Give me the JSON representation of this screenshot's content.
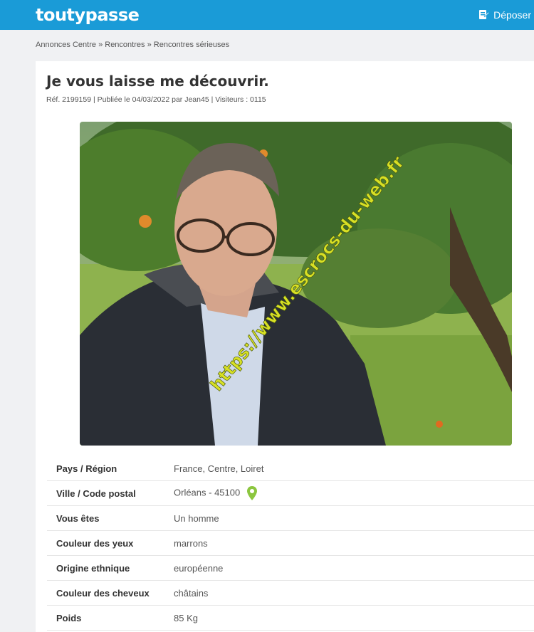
{
  "header": {
    "logo": "toutypasse",
    "deposer_label": "Déposer"
  },
  "breadcrumb": [
    "Annonces Centre",
    "Rencontres",
    "Rencontres sérieuses"
  ],
  "breadcrumb_sep": "»",
  "ad": {
    "title": "Je vous laisse me découvrir.",
    "meta": "Réf. 2199159 | Publiée le 04/03/2022 par Jean45 | Visiteurs : 0115",
    "watermark": "https://www.escrocs-du-web.fr"
  },
  "details": [
    {
      "label": "Pays / Région",
      "value": "France, Centre, Loiret"
    },
    {
      "label": "Ville / Code postal",
      "value": "Orléans - 45100"
    },
    {
      "label": "Vous êtes",
      "value": "Un homme"
    },
    {
      "label": "Couleur des yeux",
      "value": "marrons"
    },
    {
      "label": "Origine ethnique",
      "value": "européenne"
    },
    {
      "label": "Couleur des cheveux",
      "value": "châtains"
    },
    {
      "label": "Poids",
      "value": "85 Kg"
    }
  ],
  "colors": {
    "brand": "#1a9bd7",
    "pin": "#8cc63f",
    "watermark": "#d8e024"
  }
}
